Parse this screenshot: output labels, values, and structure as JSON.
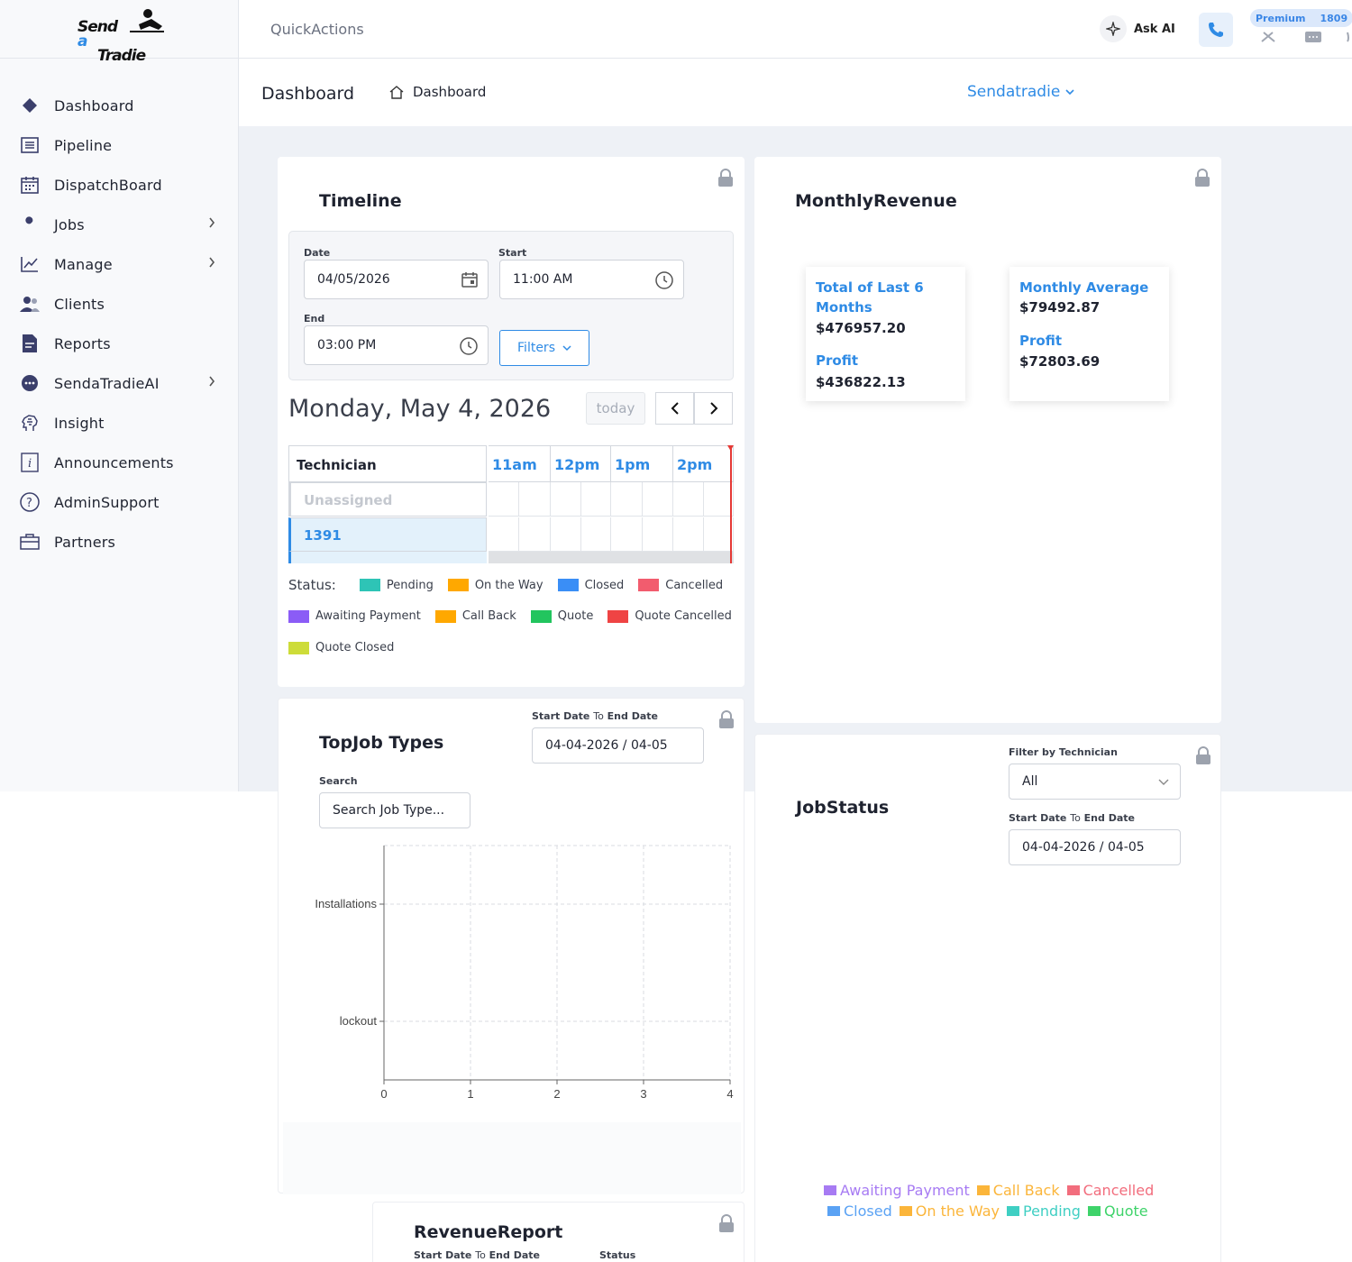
{
  "logo": {
    "line1": "Send",
    "accent": "a",
    "line2": "Tradie"
  },
  "sidebar": {
    "items": [
      {
        "label": "Dashboard",
        "icon": "diamond-icon"
      },
      {
        "label": "Pipeline",
        "icon": "list-icon"
      },
      {
        "label": "DispatchBoard",
        "icon": "calendar-icon"
      },
      {
        "label": "Jobs",
        "icon": "wrench-icon",
        "has_submenu": true
      },
      {
        "label": "Manage",
        "icon": "line-chart-icon",
        "has_submenu": true
      },
      {
        "label": "Clients",
        "icon": "users-icon"
      },
      {
        "label": "Reports",
        "icon": "document-icon"
      },
      {
        "label": "SendaTradieAI",
        "icon": "chat-dots-icon",
        "has_submenu": true
      },
      {
        "label": "Insight",
        "icon": "brain-icon"
      },
      {
        "label": "Announcements",
        "icon": "info-icon"
      },
      {
        "label": "AdminSupport",
        "icon": "question-icon"
      },
      {
        "label": "Partners",
        "icon": "briefcase-icon"
      }
    ]
  },
  "topbar": {
    "quick_actions": "QuickActions",
    "ask_ai": "Ask AI",
    "premium": "Premium",
    "premium_count": "1809"
  },
  "header": {
    "title": "Dashboard",
    "breadcrumb": "Dashboard",
    "org": "Sendatradie"
  },
  "timeline": {
    "title": "Timeline",
    "date_label": "Date",
    "date_value": "04/05/2026",
    "start_label": "Start",
    "start_value": "11:00 AM",
    "end_label": "End",
    "end_value": "03:00 PM",
    "filters": "Filters",
    "day_title": "Monday, May 4, 2026",
    "today": "today",
    "tech_header": "Technician",
    "times": [
      "11am",
      "12pm",
      "1pm",
      "2pm"
    ],
    "rows": [
      "Unassigned",
      "1391"
    ],
    "status_label": "Status:",
    "statuses": [
      {
        "label": "Pending",
        "color": "#2ec4b6"
      },
      {
        "label": "On the Way",
        "color": "#ffa800"
      },
      {
        "label": "Closed",
        "color": "#3a8ef6"
      },
      {
        "label": "Cancelled",
        "color": "#f25c6e"
      },
      {
        "label": "Awaiting Payment",
        "color": "#8b5cf6"
      },
      {
        "label": "Call Back",
        "color": "#ffa800"
      },
      {
        "label": "Quote",
        "color": "#22c55e"
      },
      {
        "label": "Quote Cancelled",
        "color": "#ef4444"
      },
      {
        "label": "Quote Closed",
        "color": "#cddc39"
      }
    ]
  },
  "monthly_revenue": {
    "title": "MonthlyRevenue",
    "box1": {
      "label": "Total of Last 6 Months",
      "value": "$476957.20",
      "profit_label": "Profit",
      "profit_value": "$436822.13"
    },
    "box2": {
      "label": "Monthly Average",
      "value": "$79492.87",
      "profit_label": "Profit",
      "profit_value": "$72803.69"
    }
  },
  "top_job_types": {
    "title": "TopJob Types",
    "range_label_a": "Start Date",
    "range_label_to": "To",
    "range_label_b": "End Date",
    "range_value": "04-04-2026 / 04-05",
    "search_label": "Search",
    "search_placeholder": "Search Job Type..."
  },
  "chart_data": {
    "type": "bar",
    "orientation": "horizontal",
    "categories": [
      "Installations",
      "lockout"
    ],
    "values": [
      0,
      0
    ],
    "x_ticks": [
      "0",
      "1",
      "2",
      "3",
      "4"
    ],
    "xlim": [
      0,
      4
    ],
    "grid": true
  },
  "job_status": {
    "title": "JobStatus",
    "filter_label": "Filter by Technician",
    "filter_value": "All",
    "range_label_a": "Start Date",
    "range_label_to": "To",
    "range_label_b": "End Date",
    "range_value": "04-04-2026 / 04-05",
    "legend": [
      {
        "label": "Awaiting Payment",
        "color": "#a77bf3"
      },
      {
        "label": "Call Back",
        "color": "#fbb53a"
      },
      {
        "label": "Cancelled",
        "color": "#f26d7d"
      },
      {
        "label": "Closed",
        "color": "#5aa2f4"
      },
      {
        "label": "On the Way",
        "color": "#fbb53a"
      },
      {
        "label": "Pending",
        "color": "#3fcfc3"
      },
      {
        "label": "Quote",
        "color": "#3ed36a"
      }
    ]
  },
  "revenue_report": {
    "title": "RevenueReport",
    "range_label_a": "Start Date",
    "range_label_to": "To",
    "range_label_b": "End Date",
    "status_label": "Status"
  }
}
